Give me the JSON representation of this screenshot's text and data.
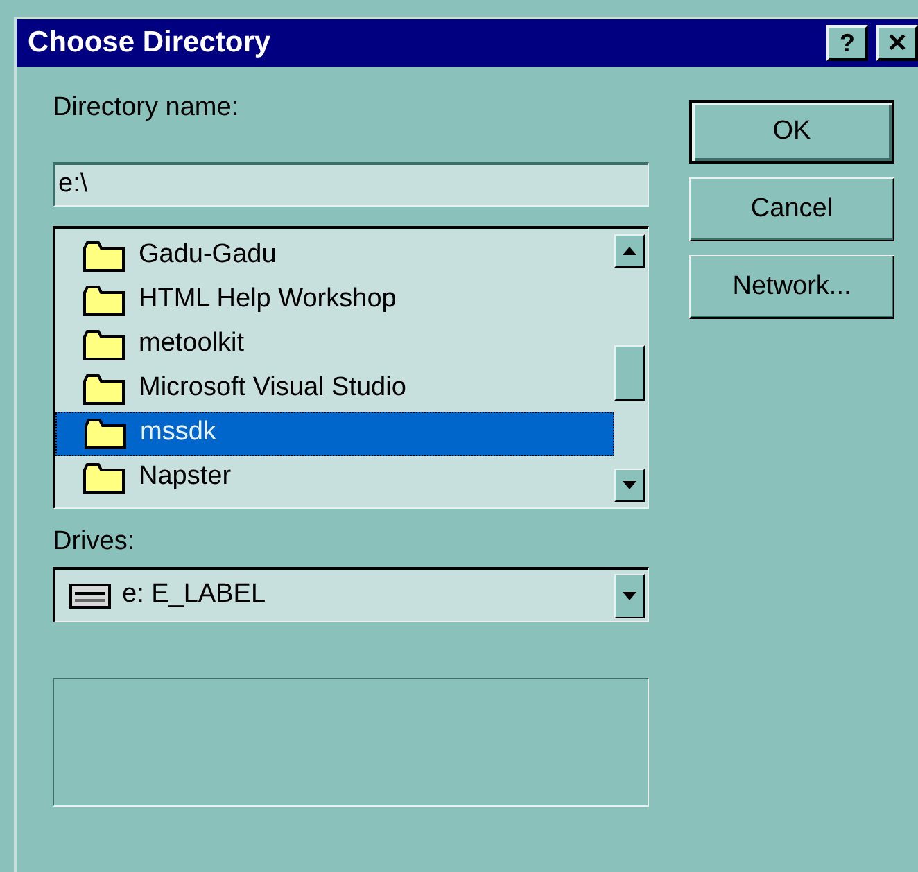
{
  "window": {
    "title": "Choose Directory",
    "title_buttons": [
      "?",
      "✕"
    ]
  },
  "directory_label": "Directory name:",
  "directory_field": {
    "value": "e:\\"
  },
  "folders": [
    {
      "name": "Gadu-Gadu",
      "selected": false
    },
    {
      "name": "HTML Help Workshop",
      "selected": false
    },
    {
      "name": "metoolkit",
      "selected": false
    },
    {
      "name": "Microsoft Visual Studio",
      "selected": false
    },
    {
      "name": "mssdk",
      "selected": true
    },
    {
      "name": "Napster",
      "selected": false
    }
  ],
  "drives_label": "Drives:",
  "drive": {
    "value": "e: E_LABEL"
  },
  "buttons": [
    {
      "label": "OK",
      "default": true
    },
    {
      "label": "Cancel",
      "default": false
    },
    {
      "label": "Network...",
      "default": false
    }
  ]
}
